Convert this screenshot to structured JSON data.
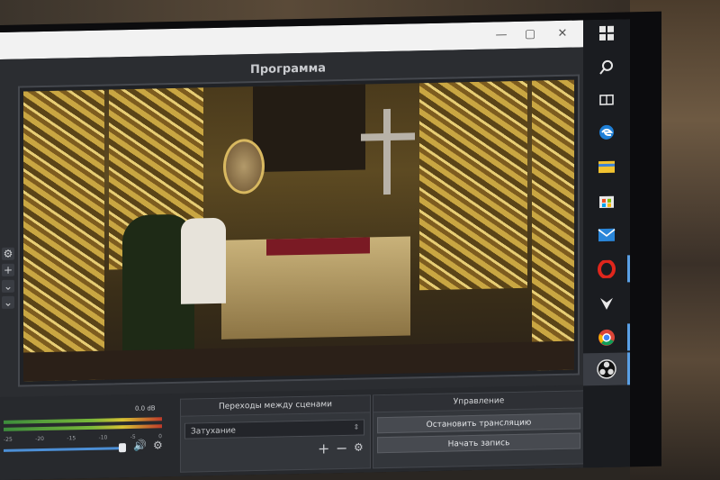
{
  "preview": {
    "title": "Программа"
  },
  "window_controls": {
    "minimize": "—",
    "maximize": "▢",
    "close": "✕"
  },
  "left_dock": {
    "icons": [
      "gear-icon",
      "plus-icon",
      "chevron-down-icon",
      "chevron-down-icon"
    ]
  },
  "audio": {
    "db_label": "0.0 dB",
    "ticks": [
      "-25",
      "-20",
      "-15",
      "-10",
      "-5",
      "0"
    ]
  },
  "transitions": {
    "title": "Переходы между сценами",
    "selected": "Затухание"
  },
  "controls": {
    "title": "Управление",
    "start_stream": "Остановить трансляцию",
    "start_record": "Начать запись"
  },
  "taskbar": {
    "icons": [
      "windows-icon",
      "search-icon",
      "task-view-icon",
      "edge-icon",
      "file-explorer-icon",
      "store-icon",
      "mail-icon",
      "opera-icon",
      "app-icon",
      "chrome-icon",
      "obs-icon"
    ]
  },
  "colors": {
    "accent": "#5aa0e6",
    "panel": "#33363b"
  }
}
